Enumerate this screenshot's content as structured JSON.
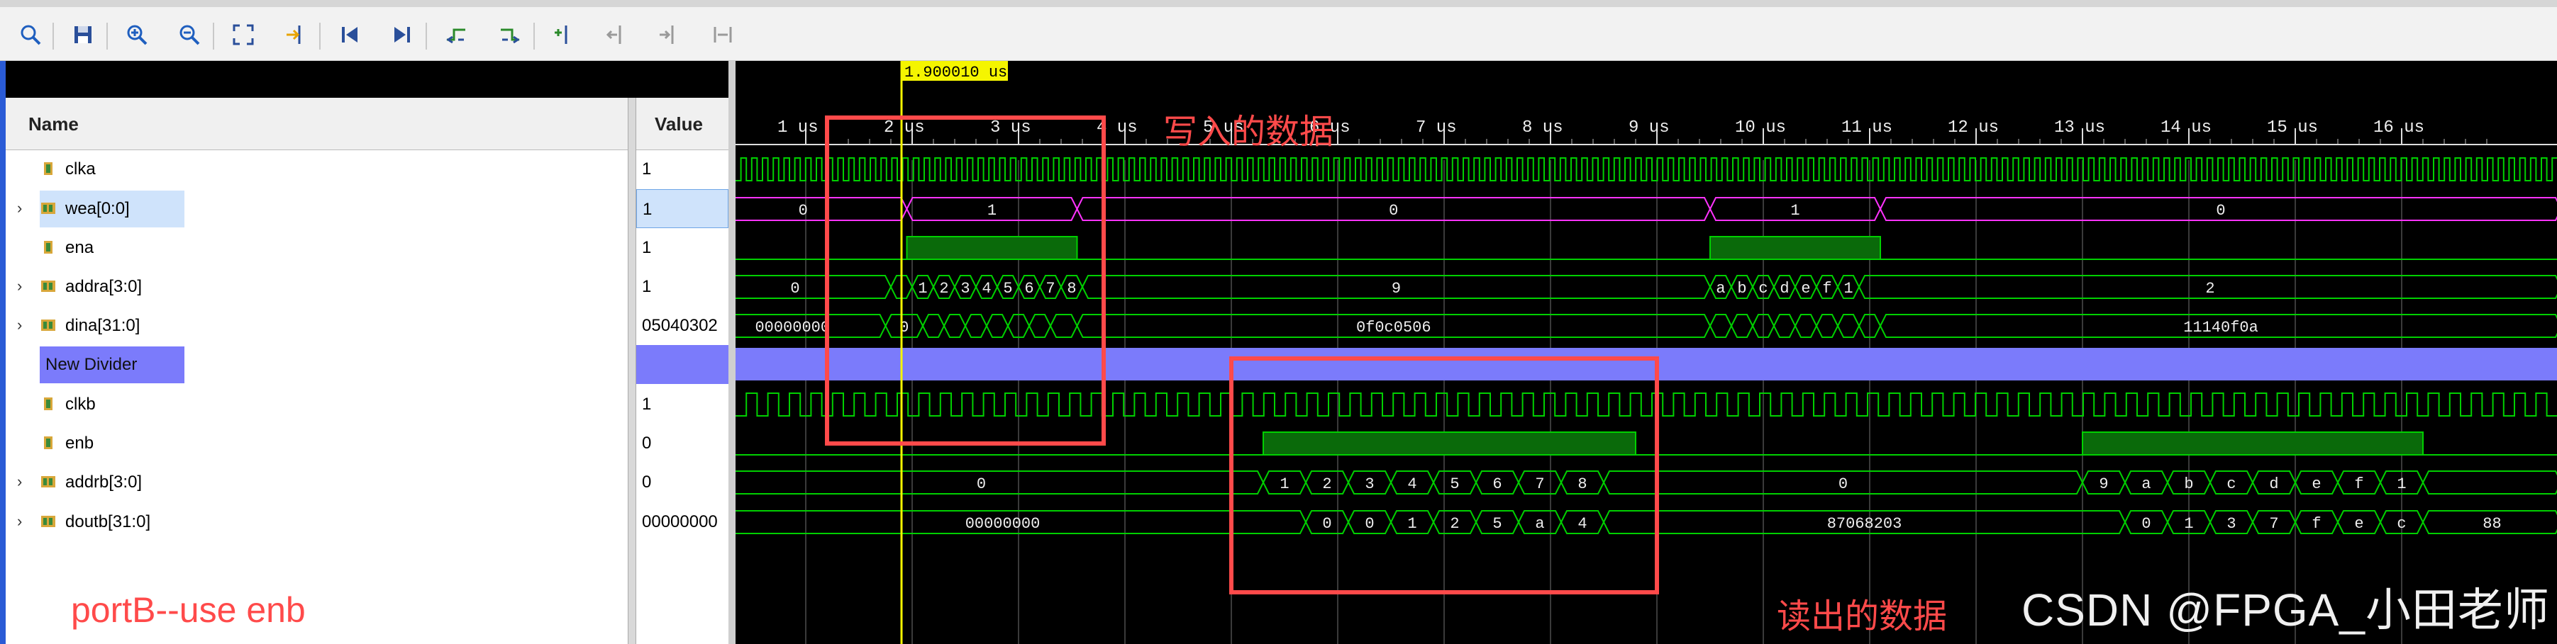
{
  "toolbar": {
    "icons": [
      "search-icon",
      "save-icon",
      "zoom-in-icon",
      "zoom-out-icon",
      "zoom-fit-icon",
      "go-to-cursor-icon",
      "go-to-time-zero-icon",
      "go-to-last-time-icon",
      "previous-transition-icon",
      "next-transition-icon",
      "add-marker-icon",
      "previous-marker-icon",
      "next-marker-icon",
      "swap-cursors-icon"
    ]
  },
  "columns": {
    "name": "Name",
    "value": "Value"
  },
  "cursor": {
    "time_label": "1.900010 us",
    "time_us": 1.90001
  },
  "timeline": {
    "unit": "us",
    "ticks": [
      "1 us",
      "2 us",
      "3 us",
      "4 us",
      "5 us",
      "6 us",
      "7 us",
      "8 us",
      "9 us",
      "10 us",
      "11 us",
      "12 us",
      "13 us",
      "14 us",
      "15 us",
      "16 us"
    ]
  },
  "signals": [
    {
      "name": "clka",
      "value": "1",
      "expandable": false,
      "icon": "bit-signal-icon"
    },
    {
      "name": "wea[0:0]",
      "value": "1",
      "expandable": true,
      "icon": "bus-signal-icon",
      "selected": true
    },
    {
      "name": "ena",
      "value": "1",
      "expandable": false,
      "icon": "bit-signal-icon"
    },
    {
      "name": "addra[3:0]",
      "value": "1",
      "expandable": true,
      "icon": "bus-signal-icon"
    },
    {
      "name": "dina[31:0]",
      "value": "05040302",
      "expandable": true,
      "icon": "bus-signal-icon"
    },
    {
      "name": "New Divider",
      "value": "",
      "divider": true
    },
    {
      "name": "clkb",
      "value": "1",
      "expandable": false,
      "icon": "bit-signal-icon"
    },
    {
      "name": "enb",
      "value": "0",
      "expandable": false,
      "icon": "bit-signal-icon"
    },
    {
      "name": "addrb[3:0]",
      "value": "0",
      "expandable": true,
      "icon": "bus-signal-icon"
    },
    {
      "name": "doutb[31:0]",
      "value": "00000000",
      "expandable": true,
      "icon": "bus-signal-icon"
    }
  ],
  "waves": {
    "wea": [
      {
        "from": 0.0,
        "to": 1.95,
        "label": "0"
      },
      {
        "from": 1.95,
        "to": 3.55,
        "label": "1"
      },
      {
        "from": 3.55,
        "to": 9.5,
        "label": "0"
      },
      {
        "from": 9.5,
        "to": 11.1,
        "label": "1"
      },
      {
        "from": 11.1,
        "to": 17.5,
        "label": "0"
      }
    ],
    "ena_high": [
      [
        1.95,
        3.55
      ],
      [
        9.5,
        11.1
      ]
    ],
    "addra": [
      {
        "from": 0.0,
        "to": 1.8,
        "label": "0"
      },
      {
        "from": 1.8,
        "to": 2.0,
        "label": ""
      },
      {
        "from": 2.0,
        "to": 2.2,
        "label": "1"
      },
      {
        "from": 2.2,
        "to": 2.4,
        "label": "2"
      },
      {
        "from": 2.4,
        "to": 2.6,
        "label": "3"
      },
      {
        "from": 2.6,
        "to": 2.8,
        "label": "4"
      },
      {
        "from": 2.8,
        "to": 3.0,
        "label": "5"
      },
      {
        "from": 3.0,
        "to": 3.2,
        "label": "6"
      },
      {
        "from": 3.2,
        "to": 3.4,
        "label": "7"
      },
      {
        "from": 3.4,
        "to": 3.6,
        "label": "8"
      },
      {
        "from": 3.6,
        "to": 9.5,
        "label": "9"
      },
      {
        "from": 9.5,
        "to": 9.7,
        "label": "a"
      },
      {
        "from": 9.7,
        "to": 9.9,
        "label": "b"
      },
      {
        "from": 9.9,
        "to": 10.1,
        "label": "c"
      },
      {
        "from": 10.1,
        "to": 10.3,
        "label": "d"
      },
      {
        "from": 10.3,
        "to": 10.5,
        "label": "e"
      },
      {
        "from": 10.5,
        "to": 10.7,
        "label": "f"
      },
      {
        "from": 10.7,
        "to": 10.9,
        "label": "1"
      },
      {
        "from": 10.9,
        "to": 17.5,
        "label": "2"
      }
    ],
    "dina": [
      {
        "from": 0.0,
        "to": 1.75,
        "label": "00000000"
      },
      {
        "from": 1.75,
        "to": 2.1,
        "label": "0"
      },
      {
        "from": 2.1,
        "to": 2.3,
        "label": ""
      },
      {
        "from": 2.3,
        "to": 2.5,
        "label": ""
      },
      {
        "from": 2.5,
        "to": 2.7,
        "label": ""
      },
      {
        "from": 2.7,
        "to": 2.9,
        "label": ""
      },
      {
        "from": 2.9,
        "to": 3.1,
        "label": ""
      },
      {
        "from": 3.1,
        "to": 3.3,
        "label": ""
      },
      {
        "from": 3.3,
        "to": 3.55,
        "label": ""
      },
      {
        "from": 3.55,
        "to": 9.5,
        "label": "0f0c0506"
      },
      {
        "from": 9.5,
        "to": 9.7,
        "label": ""
      },
      {
        "from": 9.7,
        "to": 9.9,
        "label": ""
      },
      {
        "from": 9.9,
        "to": 10.1,
        "label": ""
      },
      {
        "from": 10.1,
        "to": 10.3,
        "label": ""
      },
      {
        "from": 10.3,
        "to": 10.5,
        "label": ""
      },
      {
        "from": 10.5,
        "to": 10.7,
        "label": ""
      },
      {
        "from": 10.7,
        "to": 10.9,
        "label": ""
      },
      {
        "from": 10.9,
        "to": 11.1,
        "label": ""
      },
      {
        "from": 11.1,
        "to": 17.5,
        "label": "11140f0a"
      }
    ],
    "enb_high": [
      [
        5.3,
        8.8
      ],
      [
        13.0,
        16.2
      ]
    ],
    "addrb": [
      {
        "from": 0.0,
        "to": 5.3,
        "label": "0"
      },
      {
        "from": 5.3,
        "to": 5.7,
        "label": "1"
      },
      {
        "from": 5.7,
        "to": 6.1,
        "label": "2"
      },
      {
        "from": 6.1,
        "to": 6.5,
        "label": "3"
      },
      {
        "from": 6.5,
        "to": 6.9,
        "label": "4"
      },
      {
        "from": 6.9,
        "to": 7.3,
        "label": "5"
      },
      {
        "from": 7.3,
        "to": 7.7,
        "label": "6"
      },
      {
        "from": 7.7,
        "to": 8.1,
        "label": "7"
      },
      {
        "from": 8.1,
        "to": 8.5,
        "label": "8"
      },
      {
        "from": 8.5,
        "to": 13.0,
        "label": "0"
      },
      {
        "from": 13.0,
        "to": 13.4,
        "label": "9"
      },
      {
        "from": 13.4,
        "to": 13.8,
        "label": "a"
      },
      {
        "from": 13.8,
        "to": 14.2,
        "label": "b"
      },
      {
        "from": 14.2,
        "to": 14.6,
        "label": "c"
      },
      {
        "from": 14.6,
        "to": 15.0,
        "label": "d"
      },
      {
        "from": 15.0,
        "to": 15.4,
        "label": "e"
      },
      {
        "from": 15.4,
        "to": 15.8,
        "label": "f"
      },
      {
        "from": 15.8,
        "to": 16.2,
        "label": "1"
      },
      {
        "from": 16.2,
        "to": 17.5,
        "label": ""
      }
    ],
    "doutb": [
      {
        "from": 0.0,
        "to": 5.7,
        "label": "00000000"
      },
      {
        "from": 5.7,
        "to": 6.1,
        "label": "0"
      },
      {
        "from": 6.1,
        "to": 6.5,
        "label": "0"
      },
      {
        "from": 6.5,
        "to": 6.9,
        "label": "1"
      },
      {
        "from": 6.9,
        "to": 7.3,
        "label": "2"
      },
      {
        "from": 7.3,
        "to": 7.7,
        "label": "5"
      },
      {
        "from": 7.7,
        "to": 8.1,
        "label": "a"
      },
      {
        "from": 8.1,
        "to": 8.5,
        "label": "4"
      },
      {
        "from": 8.5,
        "to": 13.4,
        "label": "87068203"
      },
      {
        "from": 13.4,
        "to": 13.8,
        "label": "0"
      },
      {
        "from": 13.8,
        "to": 14.2,
        "label": "1"
      },
      {
        "from": 14.2,
        "to": 14.6,
        "label": "3"
      },
      {
        "from": 14.6,
        "to": 15.0,
        "label": "7"
      },
      {
        "from": 15.0,
        "to": 15.4,
        "label": "f"
      },
      {
        "from": 15.4,
        "to": 15.8,
        "label": "e"
      },
      {
        "from": 15.8,
        "to": 16.2,
        "label": "c"
      },
      {
        "from": 16.2,
        "to": 17.5,
        "label": "88"
      }
    ]
  },
  "annotations": {
    "write_label": "写入的数据",
    "read_label": "读出的数据",
    "port_label": "portB--use enb",
    "watermark": "CSDN @FPGA_小田老师"
  },
  "colors": {
    "wave_bg": "#000000",
    "wave_green": "#00d000",
    "fill_green": "#0a6a0a",
    "wea_magenta": "#ff33ff",
    "cursor_yellow": "#f5f500",
    "grid": "#3a3a3a",
    "annotation_red": "#ff4a4a",
    "divider_blue": "#7b7bfb"
  }
}
